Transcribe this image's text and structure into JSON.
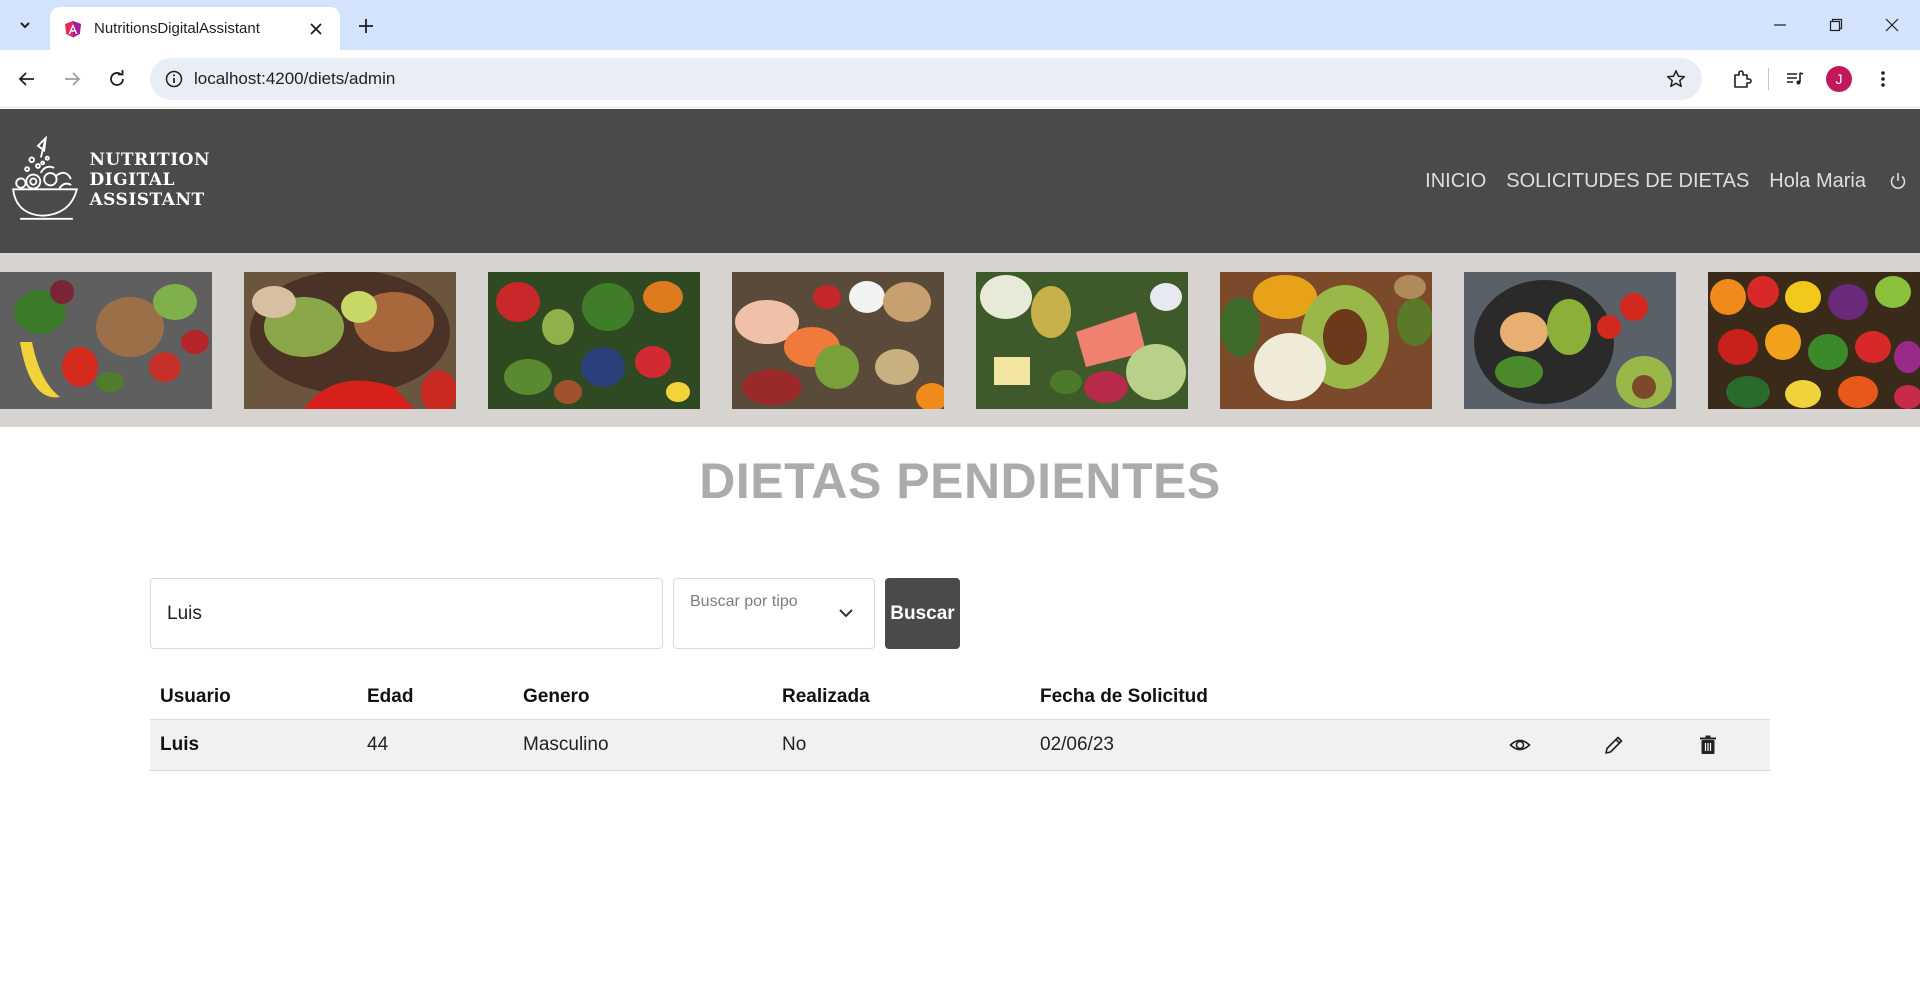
{
  "browser": {
    "tab_title": "NutritionsDigitalAssistant",
    "url": "localhost:4200/diets/admin",
    "profile_initial": "J"
  },
  "header": {
    "logo_lines": [
      "NUTRITION",
      "DIGITAL",
      "ASSISTANT"
    ],
    "nav": {
      "home": "INICIO",
      "requests": "SOLICITUDES DE DIETAS",
      "greeting": "Hola Maria"
    }
  },
  "page": {
    "title": "DIETAS PENDIENTES"
  },
  "search": {
    "value": "Luis",
    "type_placeholder": "Buscar por tipo",
    "button": "Buscar"
  },
  "table": {
    "headers": [
      "Usuario",
      "Edad",
      "Genero",
      "Realizada",
      "Fecha de Solicitud"
    ],
    "rows": [
      {
        "user": "Luis",
        "age": "44",
        "gender": "Masculino",
        "done": "No",
        "date": "02/06/23"
      }
    ]
  },
  "colors": {
    "header_bg": "#4a4a4a",
    "strip_bg": "#d6d3d1",
    "title": "#ababab",
    "button_bg": "#4a4a4a",
    "row_bg": "#f1f1f1"
  },
  "icons": {
    "row_actions": [
      "eye-icon",
      "pencil-icon",
      "trash-icon"
    ]
  }
}
